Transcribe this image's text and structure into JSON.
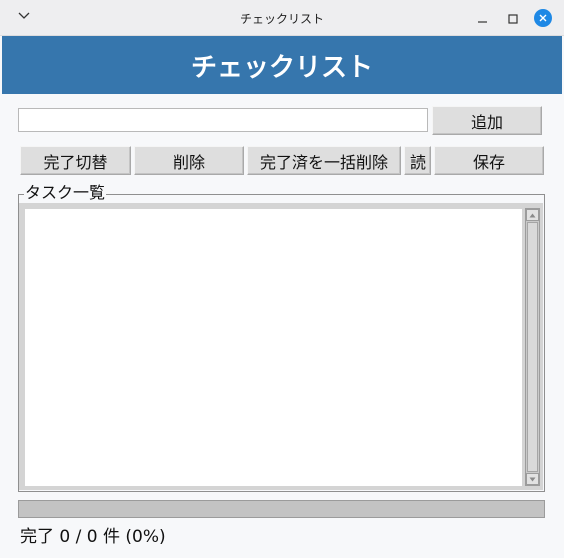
{
  "window": {
    "title": "チェックリスト"
  },
  "header": {
    "title": "チェックリスト"
  },
  "input": {
    "value": "",
    "placeholder": ""
  },
  "buttons": {
    "add": "追加",
    "toggle": "完了切替",
    "delete": "削除",
    "clear_done": "完了済を一括削除",
    "load": "読",
    "save": "保存"
  },
  "task_list": {
    "label": "タスク一覧",
    "items": []
  },
  "progress": {
    "fraction": 0
  },
  "status": {
    "text": "完了 0 / 0 件 (0%)"
  },
  "colors": {
    "header_bg": "#3676ad",
    "close_button": "#1e88e5"
  },
  "icons": {
    "menu": "chevron-down-icon",
    "minimize": "minimize-icon",
    "maximize": "maximize-icon",
    "close": "close-icon"
  }
}
